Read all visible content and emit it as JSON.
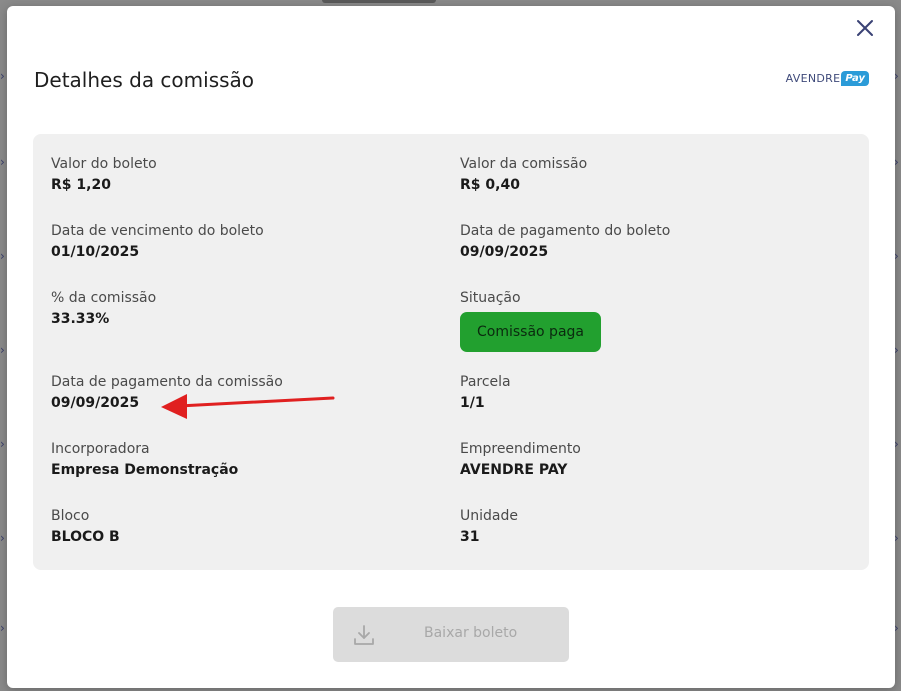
{
  "modal": {
    "title": "Detalhes da comissão",
    "brand": {
      "text": "AVENDRE",
      "badge": "Pay"
    },
    "close_icon": "close-icon"
  },
  "details": {
    "valor_boleto": {
      "label": "Valor do boleto",
      "value": "R$ 1,20"
    },
    "valor_comissao": {
      "label": "Valor da comissão",
      "value": "R$ 0,40"
    },
    "data_vencimento": {
      "label": "Data de vencimento do boleto",
      "value": "01/10/2025"
    },
    "data_pagamento_boleto": {
      "label": "Data de pagamento do boleto",
      "value": "09/09/2025"
    },
    "percentual": {
      "label": "% da comissão",
      "value": "33.33%"
    },
    "situacao": {
      "label": "Situação",
      "value": "Comissão paga"
    },
    "data_pagamento_comissao": {
      "label": "Data de pagamento da comissão",
      "value": "09/09/2025"
    },
    "parcela": {
      "label": "Parcela",
      "value": "1/1"
    },
    "incorporadora": {
      "label": "Incorporadora",
      "value": "Empresa Demonstração"
    },
    "empreendimento": {
      "label": "Empreendimento",
      "value": "AVENDRE PAY"
    },
    "bloco": {
      "label": "Bloco",
      "value": "BLOCO B"
    },
    "unidade": {
      "label": "Unidade",
      "value": "31"
    }
  },
  "actions": {
    "download_label": "Baixar boleto",
    "download_icon": "download-icon"
  },
  "colors": {
    "status_paid": "#22a02f",
    "annotation_arrow": "#e02020",
    "brand_pay": "#2b9bd8"
  }
}
